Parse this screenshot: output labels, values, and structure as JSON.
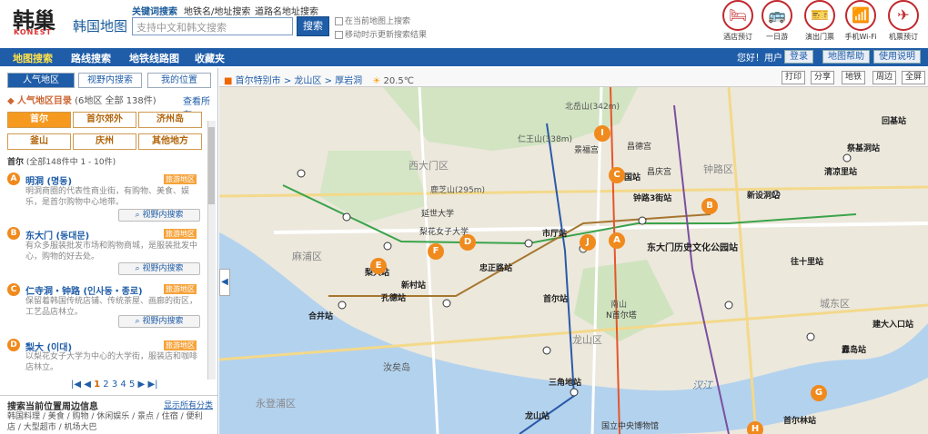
{
  "brand": {
    "logo_cn": "韩巢",
    "logo_en": "KONEST",
    "title": "韩国地图"
  },
  "search": {
    "tabs": [
      "关键词搜索",
      "地铁名/地址搜索",
      "道路名地址搜索"
    ],
    "placeholder": "支持中文和韩文搜索",
    "button": "搜索",
    "opt1": "在当前地图上搜索",
    "opt2": "移动时示更新搜索结果"
  },
  "quick_icons": [
    {
      "icon": "hotel-icon",
      "label": "酒店预订",
      "glyph": "🛏"
    },
    {
      "icon": "bus-icon",
      "label": "一日游",
      "glyph": "🚌"
    },
    {
      "icon": "ticket-icon",
      "label": "演出门票",
      "glyph": "🎫"
    },
    {
      "icon": "wifi-icon",
      "label": "手机Wi-Fi",
      "glyph": "📶"
    },
    {
      "icon": "plane-icon",
      "label": "机票预订",
      "glyph": "✈"
    }
  ],
  "nav": {
    "items": [
      "地图搜索",
      "路线搜索",
      "地铁线路图",
      "收藏夹"
    ],
    "welcome": "您好！用户",
    "login": "登录",
    "btn1": "地图帮助",
    "btn2": "使用说明"
  },
  "panel": {
    "tabs": [
      "人气地区",
      "视野内搜索",
      "我的位置"
    ],
    "header": "人气地区目录",
    "header_count": "(6地区 全部 138件)",
    "more": "查看所有",
    "regions": [
      "首尔",
      "首尔郊外",
      "济州岛",
      "釜山",
      "庆州",
      "其他地方"
    ],
    "section": "首尔",
    "section_count": "(全部148件中 1 - 10件)",
    "places": [
      {
        "letter": "A",
        "name": "明洞 (명동)",
        "tag": "旅游地区",
        "desc": "明洞商圈的代表性商业街，有购物、美食、娱乐，是首尔购物中心地带。",
        "btn": "视野内搜索"
      },
      {
        "letter": "B",
        "name": "东大门 (동대문)",
        "tag": "旅游地区",
        "desc": "有众多服装批发市场和购物商城，是服装批发中心，购物的好去处。",
        "btn": "视野内搜索"
      },
      {
        "letter": "C",
        "name": "仁寺洞・钟路 (인사동・종로)",
        "tag": "旅游地区",
        "desc": "保留着韩国传统店铺、传统茶屋、画廊的街区，工艺品店林立。",
        "btn": "视野内搜索"
      },
      {
        "letter": "D",
        "name": "梨大 (이대)",
        "tag": "旅游地区",
        "desc": "以梨花女子大学为中心的大学街，服装店和咖啡店林立。",
        "btn": "视野内搜索"
      }
    ],
    "pager": [
      "1",
      "2",
      "3",
      "4",
      "5"
    ],
    "bottom_title": "搜索当前位置周边信息",
    "bottom_more": "显示所有分类",
    "bottom_text": "韩国料理 / 美食 / 购物 / 休闲娱乐 / 景点 / 住宿 / 便利店 / 大型超市 / 机场大巴"
  },
  "mapbar": {
    "crumbs": [
      "首尔特别市",
      "龙山区",
      "厚岩洞"
    ],
    "weather": "20.5℃",
    "btns": [
      "打印",
      "分享",
      "地铁",
      "周边",
      "全屏"
    ]
  },
  "map_labels": [
    "北岳山(342m)",
    "仁王山(338m)",
    "西大门区",
    "钟路区",
    "景福宫",
    "昌德宫",
    "昌庆宫",
    "钟路3街站",
    "安国站",
    "鹿芝山(295m)",
    "延世大学",
    "梨花女子大学",
    "东大门历史文化公园站",
    "新设洞站",
    "清凉里站",
    "忠正路站",
    "市厅站",
    "南山",
    "N首尔塔",
    "孔德站",
    "麻浦区",
    "合井站",
    "新村站",
    "梨大站",
    "首尔站",
    "龙山区",
    "龙山站",
    "三角地站",
    "往十里站",
    "城东区",
    "纛岛站",
    "建大入口站",
    "汉江",
    "汝矣岛",
    "永登浦区",
    "国立中央博物馆",
    "首尔林站",
    "回基站",
    "祭基洞站"
  ],
  "map_markers": [
    "A",
    "B",
    "C",
    "D",
    "E",
    "F",
    "G",
    "H",
    "I",
    "J"
  ]
}
